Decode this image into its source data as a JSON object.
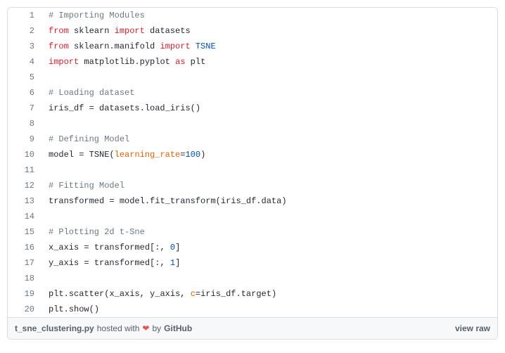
{
  "lines": [
    {
      "n": 1,
      "tokens": [
        [
          "c",
          "# Importing Modules"
        ]
      ]
    },
    {
      "n": 2,
      "tokens": [
        [
          "k",
          "from"
        ],
        [
          "n",
          " sklearn "
        ],
        [
          "kn",
          "import"
        ],
        [
          "n",
          " datasets"
        ]
      ]
    },
    {
      "n": 3,
      "tokens": [
        [
          "k",
          "from"
        ],
        [
          "n",
          " sklearn"
        ],
        [
          "op",
          "."
        ],
        [
          "n",
          "manifold "
        ],
        [
          "kn",
          "import"
        ],
        [
          "n",
          " "
        ],
        [
          "cls",
          "TSNE"
        ]
      ]
    },
    {
      "n": 4,
      "tokens": [
        [
          "k",
          "import"
        ],
        [
          "n",
          " matplotlib"
        ],
        [
          "op",
          "."
        ],
        [
          "n",
          "pyplot "
        ],
        [
          "kn",
          "as"
        ],
        [
          "n",
          " plt"
        ]
      ]
    },
    {
      "n": 5,
      "tokens": []
    },
    {
      "n": 6,
      "tokens": [
        [
          "c",
          "# Loading dataset"
        ]
      ]
    },
    {
      "n": 7,
      "tokens": [
        [
          "n",
          "iris_df "
        ],
        [
          "op",
          "="
        ],
        [
          "n",
          " datasets"
        ],
        [
          "op",
          "."
        ],
        [
          "n",
          "load_iris"
        ],
        [
          "op",
          "()"
        ]
      ]
    },
    {
      "n": 8,
      "tokens": []
    },
    {
      "n": 9,
      "tokens": [
        [
          "c",
          "# Defining Model"
        ]
      ]
    },
    {
      "n": 10,
      "tokens": [
        [
          "n",
          "model "
        ],
        [
          "op",
          "="
        ],
        [
          "n",
          " TSNE"
        ],
        [
          "op",
          "("
        ],
        [
          "param",
          "learning_rate"
        ],
        [
          "op",
          "="
        ],
        [
          "num",
          "100"
        ],
        [
          "op",
          ")"
        ]
      ]
    },
    {
      "n": 11,
      "tokens": []
    },
    {
      "n": 12,
      "tokens": [
        [
          "c",
          "# Fitting Model"
        ]
      ]
    },
    {
      "n": 13,
      "tokens": [
        [
          "n",
          "transformed "
        ],
        [
          "op",
          "="
        ],
        [
          "n",
          " model"
        ],
        [
          "op",
          "."
        ],
        [
          "n",
          "fit_transform"
        ],
        [
          "op",
          "("
        ],
        [
          "n",
          "iris_df"
        ],
        [
          "op",
          "."
        ],
        [
          "n",
          "data"
        ],
        [
          "op",
          ")"
        ]
      ]
    },
    {
      "n": 14,
      "tokens": []
    },
    {
      "n": 15,
      "tokens": [
        [
          "c",
          "# Plotting 2d t-Sne"
        ]
      ]
    },
    {
      "n": 16,
      "tokens": [
        [
          "n",
          "x_axis "
        ],
        [
          "op",
          "="
        ],
        [
          "n",
          " transformed"
        ],
        [
          "op",
          "[:"
        ],
        [
          "n",
          ", "
        ],
        [
          "num",
          "0"
        ],
        [
          "op",
          "]"
        ]
      ]
    },
    {
      "n": 17,
      "tokens": [
        [
          "n",
          "y_axis "
        ],
        [
          "op",
          "="
        ],
        [
          "n",
          " transformed"
        ],
        [
          "op",
          "[:"
        ],
        [
          "n",
          ", "
        ],
        [
          "num",
          "1"
        ],
        [
          "op",
          "]"
        ]
      ]
    },
    {
      "n": 18,
      "tokens": []
    },
    {
      "n": 19,
      "tokens": [
        [
          "n",
          "plt"
        ],
        [
          "op",
          "."
        ],
        [
          "n",
          "scatter"
        ],
        [
          "op",
          "("
        ],
        [
          "n",
          "x_axis"
        ],
        [
          "op",
          ","
        ],
        [
          "n",
          " y_axis"
        ],
        [
          "op",
          ","
        ],
        [
          "n",
          " "
        ],
        [
          "param",
          "c"
        ],
        [
          "op",
          "="
        ],
        [
          "n",
          "iris_df"
        ],
        [
          "op",
          "."
        ],
        [
          "n",
          "target"
        ],
        [
          "op",
          ")"
        ]
      ]
    },
    {
      "n": 20,
      "tokens": [
        [
          "n",
          "plt"
        ],
        [
          "op",
          "."
        ],
        [
          "n",
          "show"
        ],
        [
          "op",
          "()"
        ]
      ]
    }
  ],
  "footer": {
    "filename": "t_sne_clustering.py",
    "hosted_prefix": " hosted with ",
    "heart": "❤",
    "by_text": " by ",
    "host": "GitHub",
    "view_raw": "view raw"
  }
}
